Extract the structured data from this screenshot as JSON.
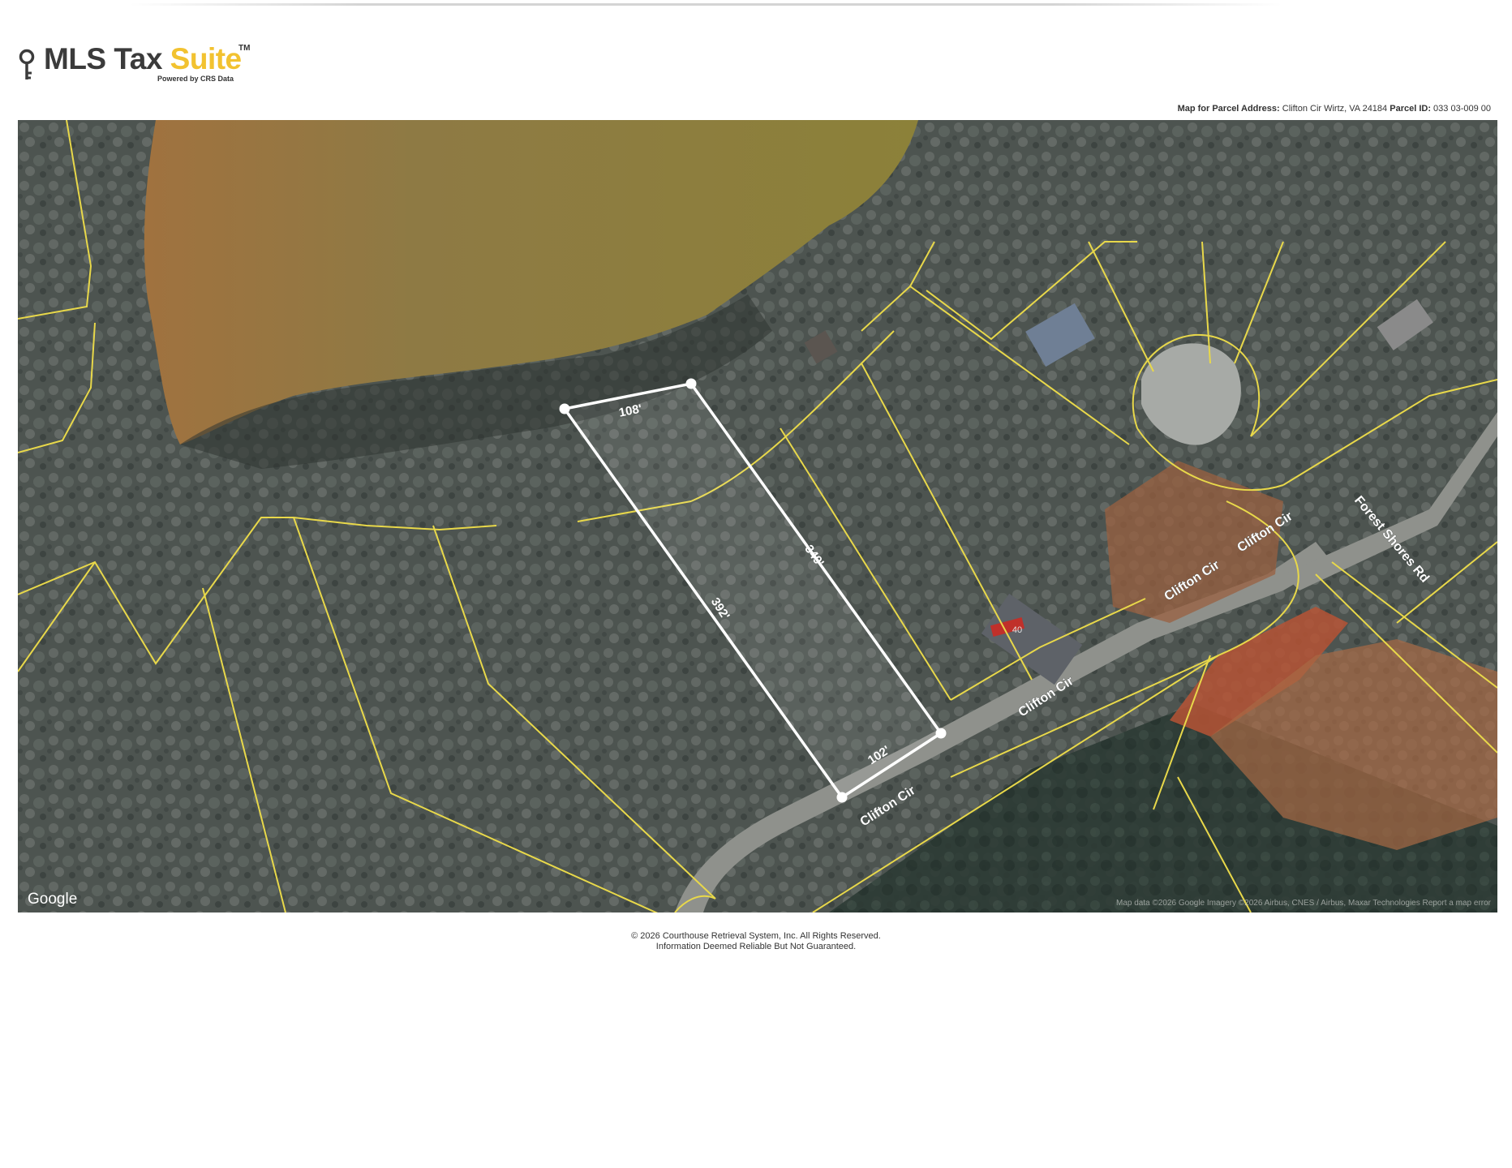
{
  "header": {
    "logo_part1": "MLS Tax ",
    "logo_part2": "Suite",
    "logo_tm": "TM",
    "logo_subtitle": "Powered by CRS Data",
    "parcel_label": "Map for Parcel Address:",
    "parcel_address": "Clifton Cir Wirtz, VA 24184",
    "parcel_id_label": "Parcel ID:",
    "parcel_id": "033 03-009 00"
  },
  "map": {
    "dimensions": {
      "top": "108'",
      "right": "349'",
      "left": "392'",
      "bottom": "102'"
    },
    "streets": {
      "clifton_1": "Clifton Cir",
      "clifton_2": "Clifton Cir",
      "clifton_3": "Clifton Cir",
      "clifton_4": "Clifton Cir",
      "forest_shores": "Forest Shores Rd"
    },
    "house_number": "40",
    "google_logo": "Google",
    "attribution": "Map data ©2026 Google Imagery ©2026 Airbus, CNES / Airbus, Maxar Technologies  Report a map error",
    "colors": {
      "parcel_lines": "#e8d84a",
      "subject_parcel": "#ffffff",
      "water": "#8f7a3c",
      "forest": "#4b534e"
    }
  },
  "footer": {
    "copyright": "© 2026 Courthouse Retrieval System, Inc. All Rights Reserved.",
    "disclaimer": "Information Deemed Reliable But Not Guaranteed."
  }
}
